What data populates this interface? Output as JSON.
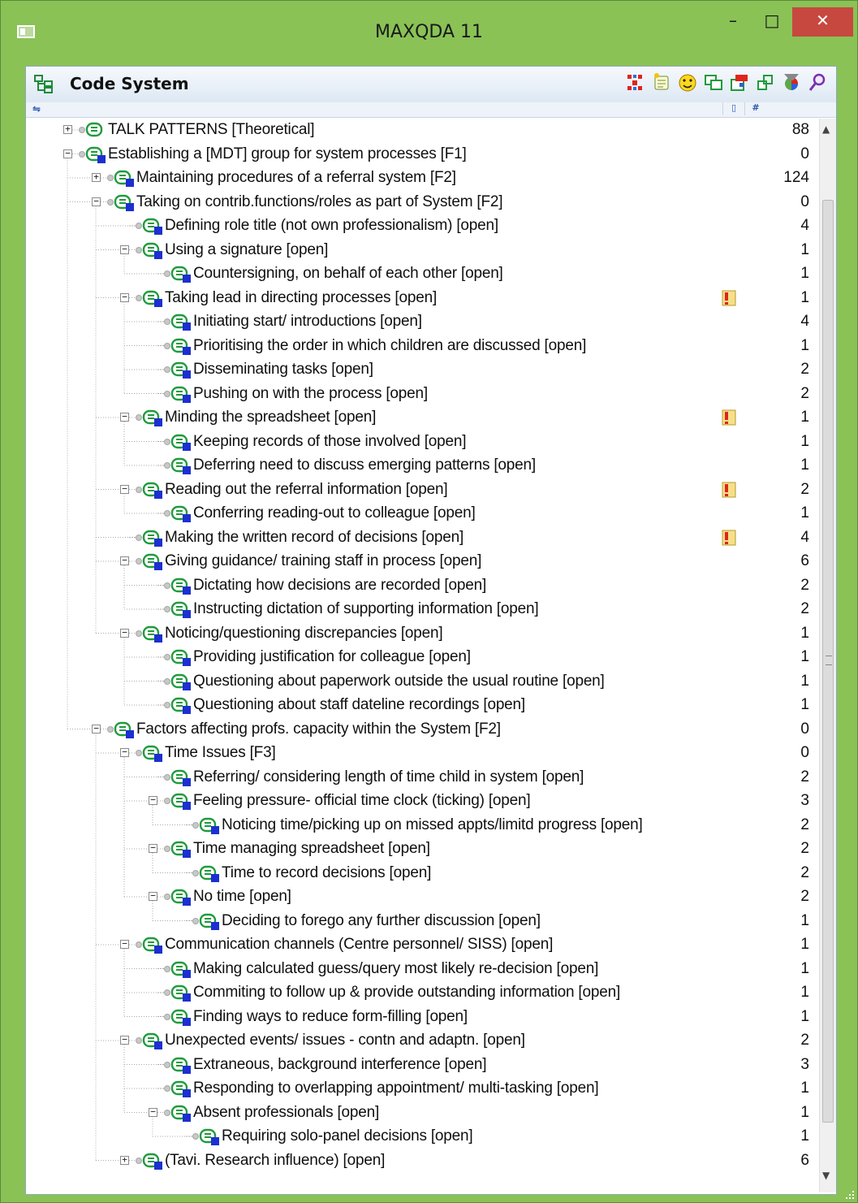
{
  "window": {
    "title": "MAXQDA 11",
    "minimize": "–",
    "maximize": "□",
    "close": "✕"
  },
  "panel": {
    "title": "Code System",
    "column_attr": "▯",
    "column_count": "#"
  },
  "colors": {
    "accent": "#8ac256",
    "close": "#c7483f",
    "code_icon_green": "#1f9b3c",
    "code_icon_blue": "#1c2fd0",
    "memo_red": "#e0241b"
  },
  "toolbar_icons": [
    "code-map-icon",
    "memo-icon",
    "emoticode-icon",
    "overview-icon",
    "activate-icon",
    "link-icon",
    "color-filter-icon",
    "search-icon"
  ],
  "rows": [
    {
      "depth": 0,
      "toggle": "+",
      "label": "TALK PATTERNS [Theoretical]",
      "count": "88",
      "memo": false,
      "icon": "plain"
    },
    {
      "depth": 0,
      "toggle": "-",
      "label": "Establishing a [MDT] group for system processes [F1]",
      "count": "0",
      "memo": false,
      "icon": "color"
    },
    {
      "depth": 1,
      "toggle": "+",
      "label": "Maintaining procedures of a referral system [F2]",
      "count": "124",
      "memo": false,
      "icon": "color"
    },
    {
      "depth": 1,
      "toggle": "-",
      "label": "Taking on contrib.functions/roles as part of System [F2]",
      "count": "0",
      "memo": false,
      "icon": "color"
    },
    {
      "depth": 2,
      "toggle": "",
      "label": "Defining role title (not own professionalism) [open]",
      "count": "4",
      "memo": false,
      "icon": "color"
    },
    {
      "depth": 2,
      "toggle": "-",
      "label": "Using a signature [open]",
      "count": "1",
      "memo": false,
      "icon": "color"
    },
    {
      "depth": 3,
      "toggle": "",
      "label": "Countersigning, on behalf of each other [open]",
      "count": "1",
      "memo": false,
      "icon": "color"
    },
    {
      "depth": 2,
      "toggle": "-",
      "label": "Taking lead in directing processes [open]",
      "count": "1",
      "memo": true,
      "icon": "color"
    },
    {
      "depth": 3,
      "toggle": "",
      "label": "Initiating start/ introductions [open]",
      "count": "4",
      "memo": false,
      "icon": "color"
    },
    {
      "depth": 3,
      "toggle": "",
      "label": "Prioritising the order in which children are discussed [open]",
      "count": "1",
      "memo": false,
      "icon": "color"
    },
    {
      "depth": 3,
      "toggle": "",
      "label": "Disseminating tasks [open]",
      "count": "2",
      "memo": false,
      "icon": "color"
    },
    {
      "depth": 3,
      "toggle": "",
      "label": "Pushing on with the process [open]",
      "count": "2",
      "memo": false,
      "icon": "color"
    },
    {
      "depth": 2,
      "toggle": "-",
      "label": "Minding the spreadsheet [open]",
      "count": "1",
      "memo": true,
      "icon": "color"
    },
    {
      "depth": 3,
      "toggle": "",
      "label": "Keeping records of those involved [open]",
      "count": "1",
      "memo": false,
      "icon": "color"
    },
    {
      "depth": 3,
      "toggle": "",
      "label": "Deferring need to discuss emerging patterns [open]",
      "count": "1",
      "memo": false,
      "icon": "color"
    },
    {
      "depth": 2,
      "toggle": "-",
      "label": "Reading out the referral information [open]",
      "count": "2",
      "memo": true,
      "icon": "color"
    },
    {
      "depth": 3,
      "toggle": "",
      "label": "Conferring reading-out to colleague [open]",
      "count": "1",
      "memo": false,
      "icon": "color"
    },
    {
      "depth": 2,
      "toggle": "",
      "label": "Making the written record of decisions [open]",
      "count": "4",
      "memo": true,
      "icon": "color"
    },
    {
      "depth": 2,
      "toggle": "-",
      "label": "Giving guidance/ training staff in process [open]",
      "count": "6",
      "memo": false,
      "icon": "color"
    },
    {
      "depth": 3,
      "toggle": "",
      "label": "Dictating how decisions are recorded [open]",
      "count": "2",
      "memo": false,
      "icon": "color"
    },
    {
      "depth": 3,
      "toggle": "",
      "label": "Instructing dictation of supporting information [open]",
      "count": "2",
      "memo": false,
      "icon": "color"
    },
    {
      "depth": 2,
      "toggle": "-",
      "label": "Noticing/questioning discrepancies [open]",
      "count": "1",
      "memo": false,
      "icon": "color"
    },
    {
      "depth": 3,
      "toggle": "",
      "label": "Providing justification for colleague [open]",
      "count": "1",
      "memo": false,
      "icon": "color"
    },
    {
      "depth": 3,
      "toggle": "",
      "label": "Questioning about paperwork outside the usual routine [open]",
      "count": "1",
      "memo": false,
      "icon": "color"
    },
    {
      "depth": 3,
      "toggle": "",
      "label": "Questioning about staff dateline recordings [open]",
      "count": "1",
      "memo": false,
      "icon": "color"
    },
    {
      "depth": 1,
      "toggle": "-",
      "label": "Factors affecting profs. capacity within the System [F2]",
      "count": "0",
      "memo": false,
      "icon": "color"
    },
    {
      "depth": 2,
      "toggle": "-",
      "label": "Time Issues [F3]",
      "count": "0",
      "memo": false,
      "icon": "color"
    },
    {
      "depth": 3,
      "toggle": "",
      "label": "Referring/ considering length of time child in system [open]",
      "count": "2",
      "memo": false,
      "icon": "color"
    },
    {
      "depth": 3,
      "toggle": "-",
      "label": "Feeling pressure- official time clock (ticking) [open]",
      "count": "3",
      "memo": false,
      "icon": "color"
    },
    {
      "depth": 4,
      "toggle": "",
      "label": "Noticing time/picking up on missed appts/limitd progress [open]",
      "count": "2",
      "memo": false,
      "icon": "color"
    },
    {
      "depth": 3,
      "toggle": "-",
      "label": "Time managing spreadsheet [open]",
      "count": "2",
      "memo": false,
      "icon": "color"
    },
    {
      "depth": 4,
      "toggle": "",
      "label": "Time to record decisions [open]",
      "count": "2",
      "memo": false,
      "icon": "color"
    },
    {
      "depth": 3,
      "toggle": "-",
      "label": "No time [open]",
      "count": "2",
      "memo": false,
      "icon": "color"
    },
    {
      "depth": 4,
      "toggle": "",
      "label": "Deciding to forego any further discussion [open]",
      "count": "1",
      "memo": false,
      "icon": "color"
    },
    {
      "depth": 2,
      "toggle": "-",
      "label": "Communication channels (Centre personnel/ SISS) [open]",
      "count": "1",
      "memo": false,
      "icon": "color"
    },
    {
      "depth": 3,
      "toggle": "",
      "label": "Making calculated guess/query most likely re-decision [open]",
      "count": "1",
      "memo": false,
      "icon": "color"
    },
    {
      "depth": 3,
      "toggle": "",
      "label": "Commiting to follow up & provide outstanding information [open]",
      "count": "1",
      "memo": false,
      "icon": "color"
    },
    {
      "depth": 3,
      "toggle": "",
      "label": "Finding ways to reduce form-filling [open]",
      "count": "1",
      "memo": false,
      "icon": "color"
    },
    {
      "depth": 2,
      "toggle": "-",
      "label": "Unexpected events/ issues - contn and adaptn. [open]",
      "count": "2",
      "memo": false,
      "icon": "color"
    },
    {
      "depth": 3,
      "toggle": "",
      "label": "Extraneous, background interference [open]",
      "count": "3",
      "memo": false,
      "icon": "color"
    },
    {
      "depth": 3,
      "toggle": "",
      "label": "Responding to overlapping appointment/ multi-tasking [open]",
      "count": "1",
      "memo": false,
      "icon": "color"
    },
    {
      "depth": 3,
      "toggle": "-",
      "label": "Absent professionals [open]",
      "count": "1",
      "memo": false,
      "icon": "color"
    },
    {
      "depth": 4,
      "toggle": "",
      "label": "Requiring solo-panel decisions [open]",
      "count": "1",
      "memo": false,
      "icon": "color"
    },
    {
      "depth": 2,
      "toggle": "+",
      "label": "(Tavi. Research influence) [open]",
      "count": "6",
      "memo": false,
      "icon": "color"
    }
  ]
}
